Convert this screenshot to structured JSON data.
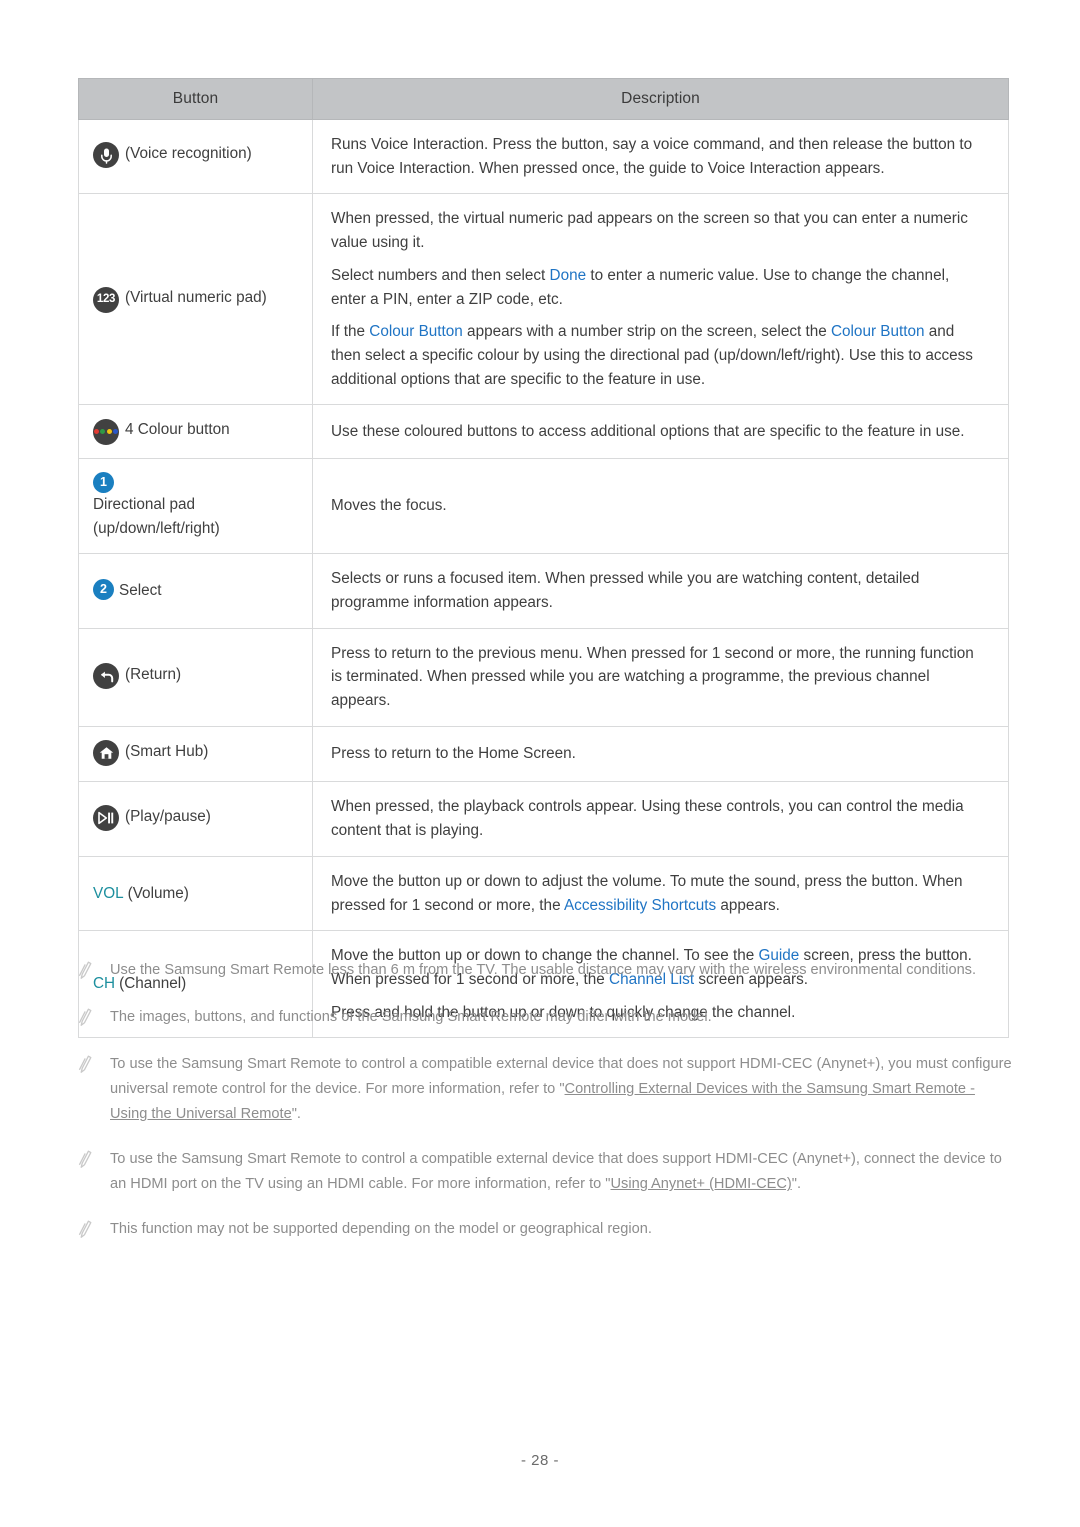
{
  "colors": {
    "link_blue": "#1f74c4",
    "key_teal": "#1c8f9e",
    "header_bg": "#c2c4c6",
    "icon_dark": "#414141",
    "badge_blue": "#1a7fc0",
    "note_gray": "#8d8d8d"
  },
  "table": {
    "headers": {
      "button": "Button",
      "description": "Description"
    },
    "rows": [
      {
        "icon": "microphone-icon",
        "label": "(Voice recognition)",
        "paragraphs": [
          [
            {
              "t": "Runs Voice Interaction. Press the button, say a voice command, and then release the button to run Voice Interaction. When pressed once, the guide to Voice Interaction appears."
            }
          ]
        ]
      },
      {
        "icon": "numeric-pad-icon",
        "icon_text": "123",
        "label": "(Virtual numeric pad)",
        "paragraphs": [
          [
            {
              "t": "When pressed, the virtual numeric pad appears on the screen so that you can enter a numeric value using it."
            }
          ],
          [
            {
              "t": "Select numbers and then select "
            },
            {
              "t": "Done",
              "s": "blue"
            },
            {
              "t": " to enter a numeric value. Use to change the channel, enter a PIN, enter a ZIP code, etc."
            }
          ],
          [
            {
              "t": "If the "
            },
            {
              "t": "Colour Button",
              "s": "blue"
            },
            {
              "t": " appears with a number strip on the screen, select the "
            },
            {
              "t": "Colour Button",
              "s": "blue"
            },
            {
              "t": " and then select a specific colour by using the directional pad (up/down/left/right). Use this to access additional options that are specific to the feature in use."
            }
          ]
        ]
      },
      {
        "icon": "four-colour-button-icon",
        "label": "4 Colour button",
        "paragraphs": [
          [
            {
              "t": "Use these coloured buttons to access additional options that are specific to the feature in use."
            }
          ]
        ]
      },
      {
        "icon": "number-badge-1-icon",
        "icon_text": "1",
        "label": "Directional pad (up/down/left/right)",
        "paragraphs": [
          [
            {
              "t": "Moves the focus."
            }
          ]
        ]
      },
      {
        "icon": "number-badge-2-icon",
        "icon_text": "2",
        "label": "Select",
        "paragraphs": [
          [
            {
              "t": "Selects or runs a focused item. When pressed while you are watching content, detailed programme information appears."
            }
          ]
        ]
      },
      {
        "icon": "return-icon",
        "label": "(Return)",
        "paragraphs": [
          [
            {
              "t": "Press to return to the previous menu. When pressed for 1 second or more, the running function is terminated. When pressed while you are watching a programme, the previous channel appears."
            }
          ]
        ]
      },
      {
        "icon": "smart-hub-home-icon",
        "label": "(Smart Hub)",
        "paragraphs": [
          [
            {
              "t": "Press to return to the Home Screen."
            }
          ]
        ]
      },
      {
        "icon": "play-pause-icon",
        "label": "(Play/pause)",
        "paragraphs": [
          [
            {
              "t": "When pressed, the playback controls appear. Using these controls, you can control the media content that is playing."
            }
          ]
        ]
      },
      {
        "icon": "volume-key-icon",
        "key_text": "VOL",
        "label": "(Volume)",
        "paragraphs": [
          [
            {
              "t": "Move the button up or down to adjust the volume. To mute the sound, press the button. When pressed for 1 second or more, the "
            },
            {
              "t": "Accessibility Shortcuts",
              "s": "blue"
            },
            {
              "t": " appears."
            }
          ]
        ]
      },
      {
        "icon": "channel-key-icon",
        "key_text": "CH",
        "label": "(Channel)",
        "paragraphs": [
          [
            {
              "t": "Move the button up or down to change the channel. To see the "
            },
            {
              "t": "Guide",
              "s": "blue"
            },
            {
              "t": " screen, press the button. When pressed for 1 second or more, the "
            },
            {
              "t": "Channel List",
              "s": "blue"
            },
            {
              "t": " screen appears."
            }
          ],
          [
            {
              "t": "Press and hold the button up or down to quickly change the channel."
            }
          ]
        ]
      }
    ]
  },
  "notes": [
    {
      "icon": "pencil-note-icon",
      "parts": [
        {
          "t": "Use the Samsung Smart Remote less than 6 m from the TV. The usable distance may vary with the wireless environmental conditions."
        }
      ]
    },
    {
      "icon": "pencil-note-icon",
      "parts": [
        {
          "t": "The images, buttons, and functions of the Samsung Smart Remote may differ with the model."
        }
      ]
    },
    {
      "icon": "pencil-note-icon",
      "parts": [
        {
          "t": "To use the Samsung Smart Remote to control a compatible external device that does not support HDMI-CEC (Anynet+), you must configure universal remote control for the device. For more information, refer to \""
        },
        {
          "t": "Controlling External Devices with the Samsung Smart Remote - Using the Universal Remote",
          "s": "ul"
        },
        {
          "t": "\"."
        }
      ]
    },
    {
      "icon": "pencil-note-icon",
      "parts": [
        {
          "t": "To use the Samsung Smart Remote to control a compatible external device that does support HDMI-CEC (Anynet+), connect the device to an HDMI port on the TV using an HDMI cable. For more information, refer to \""
        },
        {
          "t": "Using Anynet+ (HDMI-CEC)",
          "s": "ul"
        },
        {
          "t": "\"."
        }
      ]
    },
    {
      "icon": "pencil-note-icon",
      "parts": [
        {
          "t": "This function may not be supported depending on the model or geographical region."
        }
      ]
    }
  ],
  "page_number": "- 28 -"
}
